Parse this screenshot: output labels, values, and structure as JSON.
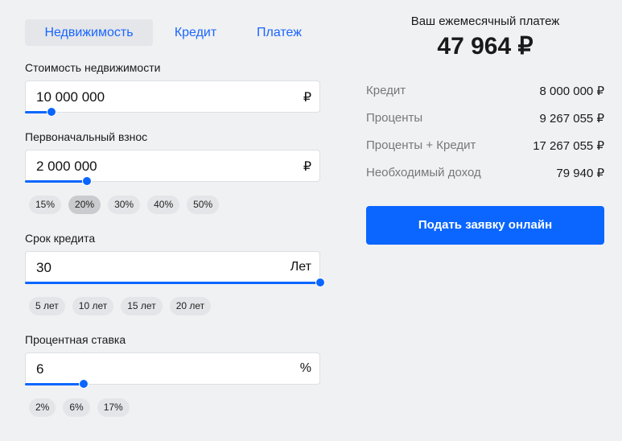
{
  "tabs": [
    {
      "label": "Недвижимость",
      "active": true
    },
    {
      "label": "Кредит"
    },
    {
      "label": "Платеж"
    }
  ],
  "fields": {
    "cost": {
      "label": "Стоимость недвижимости",
      "value": "10 000 000",
      "unit": "₽",
      "slider_fraction": 0.09
    },
    "down": {
      "label": "Первоначальный взнос",
      "value": "2 000 000",
      "unit": "₽",
      "slider_fraction": 0.21,
      "chips": [
        "15%",
        "20%",
        "30%",
        "40%",
        "50%"
      ],
      "selected": "20%"
    },
    "term": {
      "label": "Срок кредита",
      "value": "30",
      "unit": "Лет",
      "slider_fraction": 1.0,
      "chips": [
        "5 лет",
        "10 лет",
        "15 лет",
        "20 лет"
      ]
    },
    "rate": {
      "label": "Процентная ставка",
      "value": "6",
      "unit": "%",
      "slider_fraction": 0.2,
      "chips": [
        "2%",
        "6%",
        "17%"
      ]
    }
  },
  "summary": {
    "title": "Ваш ежемесячный платеж",
    "amount": "47 964 ₽",
    "rows": [
      {
        "k": "Кредит",
        "v": "8 000 000 ₽"
      },
      {
        "k": "Проценты",
        "v": "9 267 055 ₽"
      },
      {
        "k": "Проценты + Кредит",
        "v": "17 267 055 ₽"
      },
      {
        "k": "Необходимый доход",
        "v": "79 940 ₽"
      }
    ],
    "button": "Подать заявку онлайн"
  },
  "colors": {
    "accent": "#0a66ff"
  }
}
